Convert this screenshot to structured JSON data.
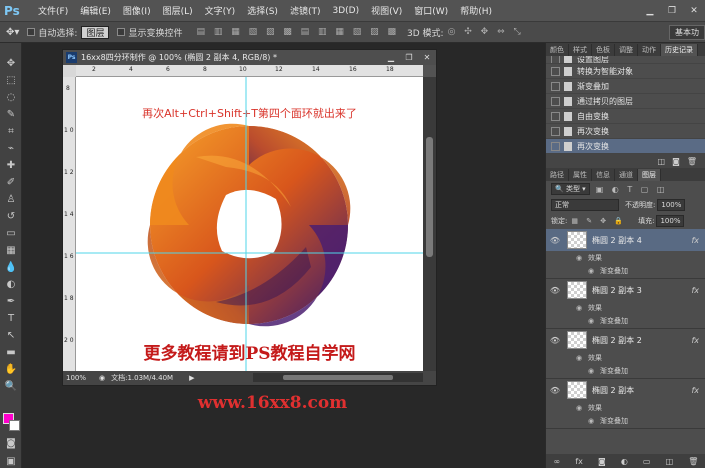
{
  "app": {
    "logo": "Ps",
    "menu": [
      "文件(F)",
      "编辑(E)",
      "图像(I)",
      "图层(L)",
      "文字(Y)",
      "选择(S)",
      "滤镜(T)",
      "3D(D)",
      "视图(V)",
      "窗口(W)",
      "帮助(H)"
    ]
  },
  "options": {
    "auto_select_label": "自动选择:",
    "auto_select_value": "图层",
    "show_transform_label": "显示变换控件",
    "mode_3d_label": "3D 模式:",
    "workspace": "基本功"
  },
  "document": {
    "title": "16xx8四分环制作 @ 100% (椭圆 2 副本 4, RGB/8) *",
    "zoom": "100%",
    "doc_size": "文档:1.03M/4.40M",
    "ruler_h_labels": [
      "2",
      "4",
      "6",
      "8",
      "10",
      "12",
      "14",
      "16",
      "18"
    ],
    "ruler_v_labels": [
      "8",
      "1 0",
      "1 2",
      "1 4",
      "1 6",
      "1 8",
      "2 0"
    ],
    "headline": "再次Alt+Ctrl+Shift+T第四个面环就出来了",
    "footer": "更多教程请到PS教程自学网"
  },
  "watermark": "www.16xx8.com",
  "history_panel": {
    "tabs": [
      "颜色",
      "样式",
      "色板",
      "调整",
      "动作",
      "历史记录"
    ],
    "active_tab": "历史记录",
    "items": [
      "设置图层",
      "转换为智能对象",
      "渐变叠加",
      "通过拷贝的图层",
      "自由变换",
      "再次变换",
      "再次变换"
    ],
    "selected_index": 6
  },
  "layers_panel": {
    "tabs": [
      "路径",
      "属性",
      "信息",
      "通道",
      "图层"
    ],
    "active_tab": "图层",
    "filter_label": "类型",
    "blend_mode": "正常",
    "opacity_label": "不透明度:",
    "opacity": "100%",
    "lock_label": "锁定:",
    "fill_label": "填充:",
    "fill": "100%",
    "layers": [
      {
        "name": "椭圆 2 副本 4",
        "effects_label": "效果",
        "effect": "渐变叠加",
        "fx": "fx",
        "selected": true
      },
      {
        "name": "椭圆 2 副本 3",
        "effects_label": "效果",
        "effect": "渐变叠加",
        "fx": "fx",
        "selected": false
      },
      {
        "name": "椭圆 2 副本 2",
        "effects_label": "效果",
        "effect": "渐变叠加",
        "fx": "fx",
        "selected": false
      },
      {
        "name": "椭圆 2 副本",
        "effects_label": "效果",
        "effect": "渐变叠加",
        "fx": "fx",
        "selected": false
      }
    ]
  },
  "colors": {
    "foreground": "#ff00cc",
    "background": "#ffffff",
    "ring_light": "#f28a1a",
    "ring_dark": "#3a1a6b",
    "guide": "#4fd6e8"
  }
}
